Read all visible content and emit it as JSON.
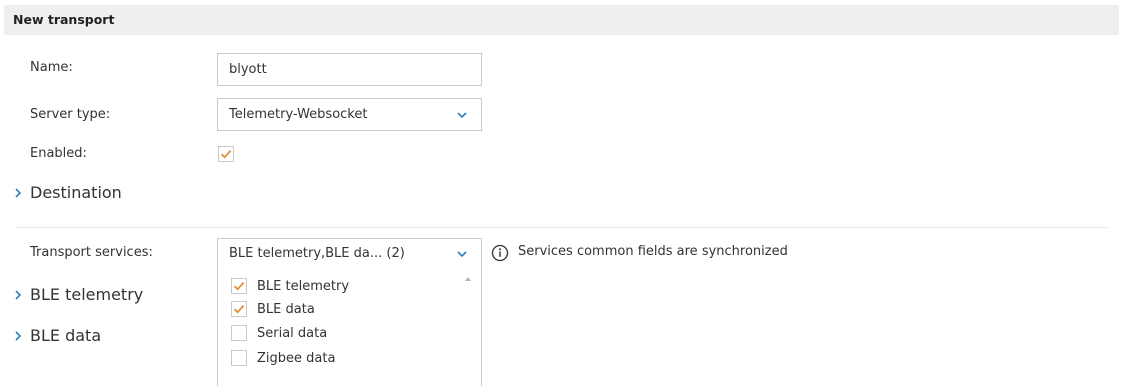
{
  "header": {
    "title": "New transport"
  },
  "form": {
    "name_label": "Name:",
    "name_value": "blyott",
    "server_type_label": "Server type:",
    "server_type_value": "Telemetry-Websocket",
    "enabled_label": "Enabled:",
    "enabled_checked": true
  },
  "sections": {
    "destination": "Destination",
    "ble_telemetry": "BLE telemetry",
    "ble_data": "BLE data"
  },
  "transport_services": {
    "label": "Transport services:",
    "selected_summary": "BLE telemetry,BLE da... (2)",
    "info_text": "Services common fields are synchronized",
    "options": [
      {
        "label": "BLE telemetry",
        "checked": true
      },
      {
        "label": "BLE data",
        "checked": true
      },
      {
        "label": "Serial data",
        "checked": false
      },
      {
        "label": "Zigbee data",
        "checked": false
      }
    ]
  },
  "colors": {
    "check_accent": "#e0903a",
    "chevron_accent": "#2a7fbf",
    "header_bg": "#efeff0"
  },
  "icons": {
    "dropdown": "chevron-down-icon",
    "section": "chevron-right-icon",
    "info": "info-circle-icon",
    "check": "checkmark-icon"
  }
}
